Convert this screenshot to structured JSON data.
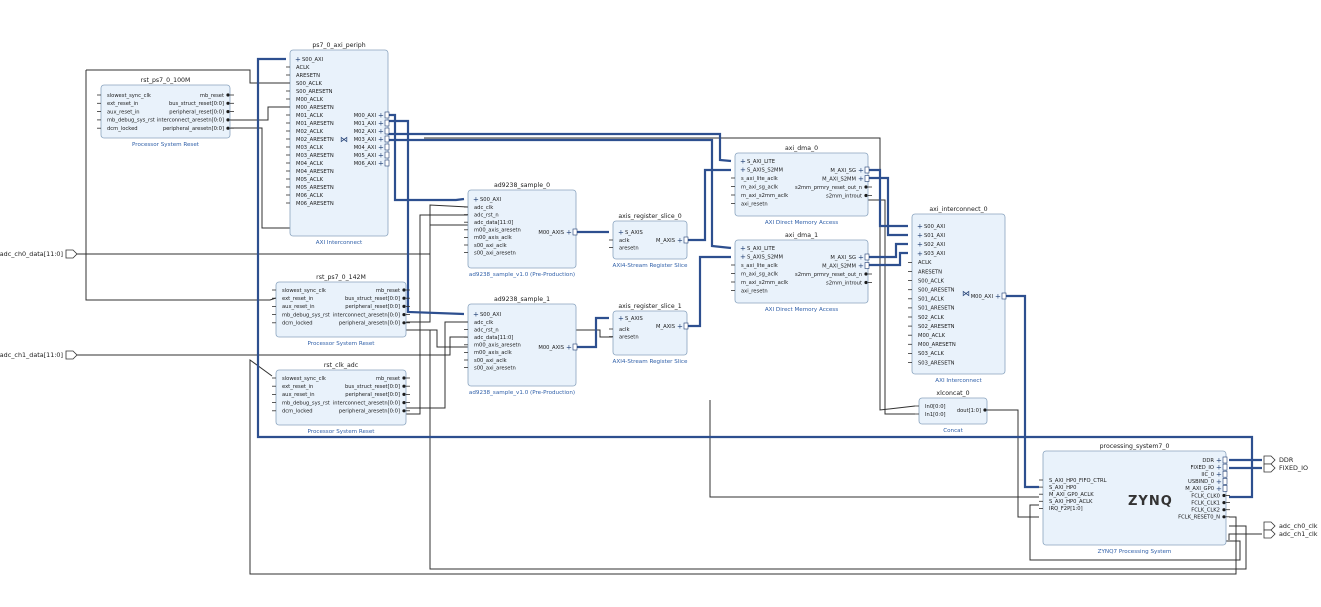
{
  "blocks": {
    "rst100": {
      "title": "rst_ps7_0_100M",
      "subtitle": "Processor System Reset",
      "left_ports": [
        "slowest_sync_clk",
        "ext_reset_in",
        "aux_reset_in",
        "mb_debug_sys_rst",
        "dcm_locked"
      ],
      "right_ports": [
        "mb_reset",
        "bus_struct_reset[0:0]",
        "peripheral_reset[0:0]",
        "interconnect_aresetn[0:0]",
        "peripheral_aresetn[0:0]"
      ]
    },
    "periph": {
      "title": "ps7_0_axi_periph",
      "subtitle": "AXI Interconnect",
      "bus_in": "S00_AXI",
      "left_ports": [
        "ACLK",
        "ARESETN",
        "S00_ACLK",
        "S00_ARESETN",
        "M00_ACLK",
        "M00_ARESETN",
        "M01_ACLK",
        "M01_ARESETN",
        "M02_ACLK",
        "M02_ARESETN",
        "M03_ACLK",
        "M03_ARESETN",
        "M04_ACLK",
        "M04_ARESETN",
        "M05_ACLK",
        "M05_ARESETN",
        "M06_ACLK",
        "M06_ARESETN"
      ],
      "right_ports": [
        "M00_AXI",
        "M01_AXI",
        "M02_AXI",
        "M03_AXI",
        "M04_AXI",
        "M05_AXI",
        "M06_AXI"
      ]
    },
    "sample0": {
      "title": "ad9238_sample_0",
      "subtitle": "ad9238_sample_v1.0 (Pre-Production)",
      "bus_in": "S00_AXI",
      "left_ports": [
        "adc_clk",
        "adc_rst_n",
        "adc_data[11:0]",
        "m00_axis_aresetn",
        "m00_axis_aclk",
        "s00_axi_aclk",
        "s00_axi_aresetn"
      ],
      "right_ports": [
        "M00_AXIS"
      ]
    },
    "sample1": {
      "title": "ad9238_sample_1",
      "subtitle": "ad9238_sample_v1.0 (Pre-Production)",
      "bus_in": "S00_AXI",
      "left_ports": [
        "adc_clk",
        "adc_rst_n",
        "adc_data[11:0]",
        "m00_axis_aresetn",
        "m00_axis_aclk",
        "s00_axi_aclk",
        "s00_axi_aresetn"
      ],
      "right_ports": [
        "M00_AXIS"
      ]
    },
    "slice0": {
      "title": "axis_register_slice_0",
      "subtitle": "AXI4-Stream Register Slice",
      "bus_in": "S_AXIS",
      "left_ports": [
        "aclk",
        "aresetn"
      ],
      "right_ports": [
        "M_AXIS"
      ]
    },
    "slice1": {
      "title": "axis_register_slice_1",
      "subtitle": "AXI4-Stream Register Slice",
      "bus_in": "S_AXIS",
      "left_ports": [
        "aclk",
        "aresetn"
      ],
      "right_ports": [
        "M_AXIS"
      ]
    },
    "dma0": {
      "title": "axi_dma_0",
      "subtitle": "AXI Direct Memory Access",
      "left_ports": [
        "S_AXI_LITE",
        "S_AXIS_S2MM",
        "s_axi_lite_aclk",
        "m_axi_sg_aclk",
        "m_axi_s2mm_aclk",
        "axi_resetn"
      ],
      "right_ports": [
        "M_AXI_SG",
        "M_AXI_S2MM",
        "s2mm_prmry_reset_out_n",
        "s2mm_introut"
      ]
    },
    "dma1": {
      "title": "axi_dma_1",
      "subtitle": "AXI Direct Memory Access",
      "left_ports": [
        "S_AXI_LITE",
        "S_AXIS_S2MM",
        "s_axi_lite_aclk",
        "m_axi_sg_aclk",
        "m_axi_s2mm_aclk",
        "axi_resetn"
      ],
      "right_ports": [
        "M_AXI_SG",
        "M_AXI_S2MM",
        "s2mm_prmry_reset_out_n",
        "s2mm_introut"
      ]
    },
    "rst142": {
      "title": "rst_ps7_0_142M",
      "subtitle": "Processor System Reset",
      "left_ports": [
        "slowest_sync_clk",
        "ext_reset_in",
        "aux_reset_in",
        "mb_debug_sys_rst",
        "dcm_locked"
      ],
      "right_ports": [
        "mb_reset",
        "bus_struct_reset[0:0]",
        "peripheral_reset[0:0]",
        "interconnect_aresetn[0:0]",
        "peripheral_aresetn[0:0]"
      ]
    },
    "rstadc": {
      "title": "rst_clk_adc",
      "subtitle": "Processor System Reset",
      "left_ports": [
        "slowest_sync_clk",
        "ext_reset_in",
        "aux_reset_in",
        "mb_debug_sys_rst",
        "dcm_locked"
      ],
      "right_ports": [
        "mb_reset",
        "bus_struct_reset[0:0]",
        "peripheral_reset[0:0]",
        "interconnect_aresetn[0:0]",
        "peripheral_aresetn[0:0]"
      ]
    },
    "ic0": {
      "title": "axi_interconnect_0",
      "subtitle": "AXI Interconnect",
      "left_ports": [
        "S00_AXI",
        "S01_AXI",
        "S02_AXI",
        "S03_AXI",
        "ACLK",
        "ARESETN",
        "S00_ACLK",
        "S00_ARESETN",
        "S01_ACLK",
        "S01_ARESETN",
        "S02_ACLK",
        "S02_ARESETN",
        "M00_ACLK",
        "M00_ARESETN",
        "S03_ACLK",
        "S03_ARESETN"
      ],
      "right_ports": [
        "M00_AXI"
      ]
    },
    "concat": {
      "title": "xlconcat_0",
      "subtitle": "Concat",
      "left_ports": [
        "In0[0:0]",
        "In1[0:0]"
      ],
      "right_ports": [
        "dout[1:0]"
      ]
    },
    "ps": {
      "title": "processing_system7_0",
      "subtitle": "ZYNQ7 Processing System",
      "logo": "ZYNQ",
      "left_ports": [
        "S_AXI_HP0_FIFO_CTRL",
        "S_AXI_HP0",
        "M_AXI_GP0_ACLK",
        "S_AXI_HP0_ACLK",
        "IRQ_F2P[1:0]"
      ],
      "right_ports": [
        "DDR",
        "FIXED_IO",
        "IIC_0",
        "USBIND_0",
        "M_AXI_GP0",
        "FCLK_CLK0",
        "FCLK_CLK1",
        "FCLK_CLK2",
        "FCLK_RESET0_N"
      ]
    }
  },
  "external_ports": {
    "adc_ch0_data": "adc_ch0_data[11:0]",
    "adc_ch1_data": "adc_ch1_data[11:0]",
    "ddr": "DDR",
    "fixed_io": "FIXED_IO",
    "adc_ch0_clk": "adc_ch0_clk",
    "adc_ch1_clk": "adc_ch1_clk"
  },
  "colors": {
    "block_fill": "#e9f2fb",
    "block_stroke": "#8aa4bf",
    "wire": "#303030",
    "bus": "#2d4f8f",
    "title": "#1b1b1b",
    "subtitle": "#2f5fa8"
  }
}
